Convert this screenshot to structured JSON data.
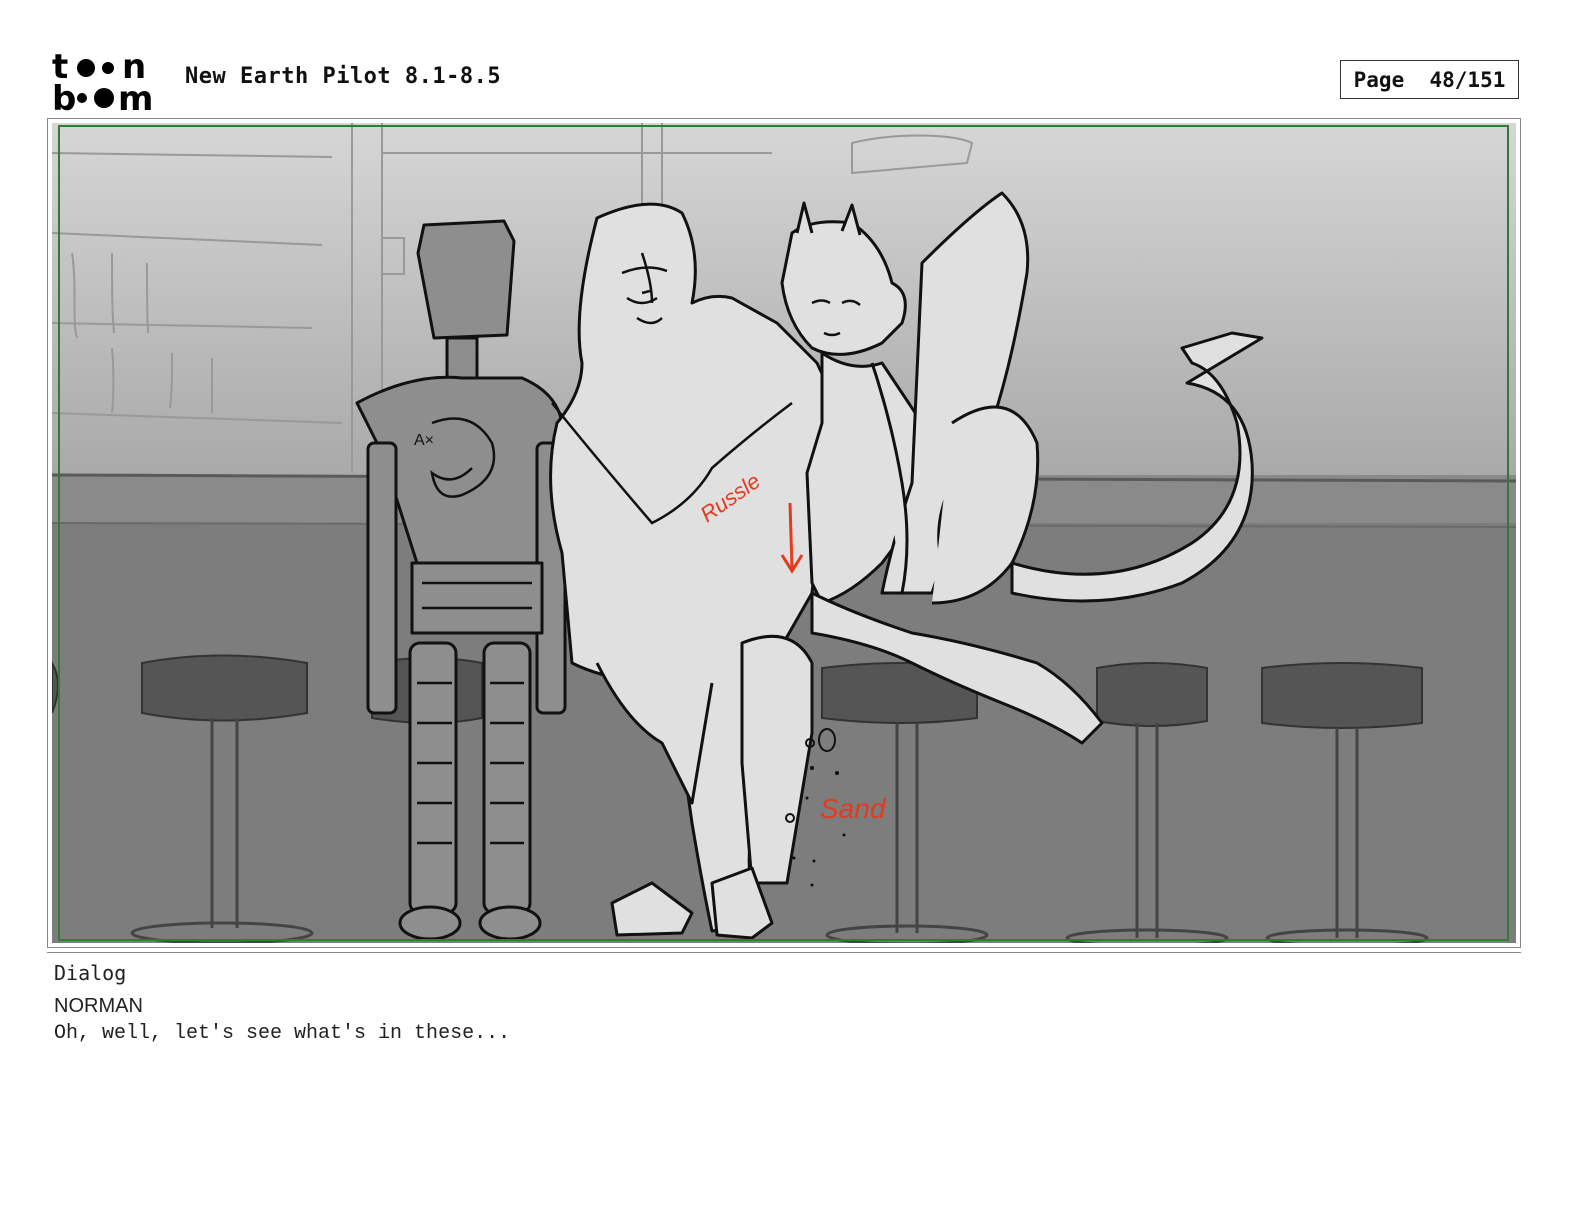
{
  "header": {
    "logo_text": "toon boom",
    "title": "New Earth Pilot 8.1-8.5",
    "page": "Page  48/151"
  },
  "panel": {
    "annotations": {
      "left": "Russle",
      "right": "Sand"
    },
    "colors": {
      "safe_frame": "#2e7d32",
      "annotation": "#e53a1e"
    }
  },
  "notes": {
    "section_label": "Dialog",
    "speaker": "NORMAN",
    "line": "Oh, well, let's see what's in these..."
  }
}
